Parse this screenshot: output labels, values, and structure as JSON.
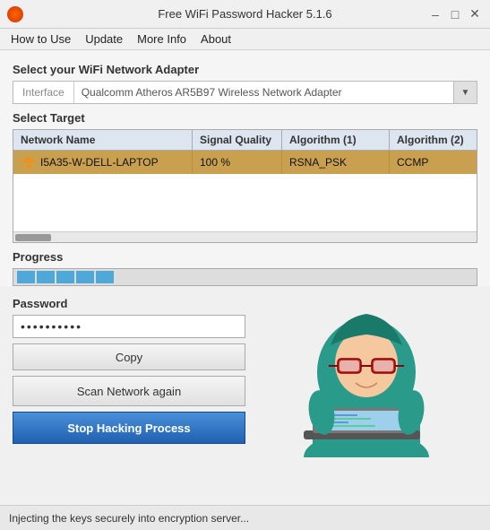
{
  "window": {
    "title": "Free WiFi Password Hacker 5.1.6",
    "app_icon": "wifi-hacker-icon",
    "controls": {
      "minimize": "–",
      "maximize": "□",
      "close": "✕"
    }
  },
  "menu": {
    "items": [
      {
        "label": "How to Use",
        "id": "how-to-use"
      },
      {
        "label": "Update",
        "id": "update"
      },
      {
        "label": "More Info",
        "id": "more-info"
      },
      {
        "label": "About",
        "id": "about"
      }
    ]
  },
  "adapter": {
    "section_label": "Select your WiFi Network Adapter",
    "label": "Interface",
    "value": "Qualcomm Atheros AR5B97 Wireless Network Adapter",
    "arrow": "▼"
  },
  "target": {
    "section_label": "Select Target",
    "columns": [
      "Network Name",
      "Signal Quality",
      "Algorithm (1)",
      "Algorithm (2)"
    ],
    "rows": [
      {
        "name": "I5A35-W-DELL-LAPTOP",
        "signal": "100 %",
        "algo1": "RSNA_PSK",
        "algo2": "CCMP"
      }
    ]
  },
  "progress": {
    "section_label": "Progress",
    "blocks": 5
  },
  "password": {
    "section_label": "Password",
    "value": "**********",
    "placeholder": "**********",
    "copy_label": "Copy"
  },
  "buttons": {
    "scan_label": "Scan Network again",
    "stop_label": "Stop Hacking Process"
  },
  "status": {
    "text": "Injecting the keys securely into encryption server..."
  }
}
